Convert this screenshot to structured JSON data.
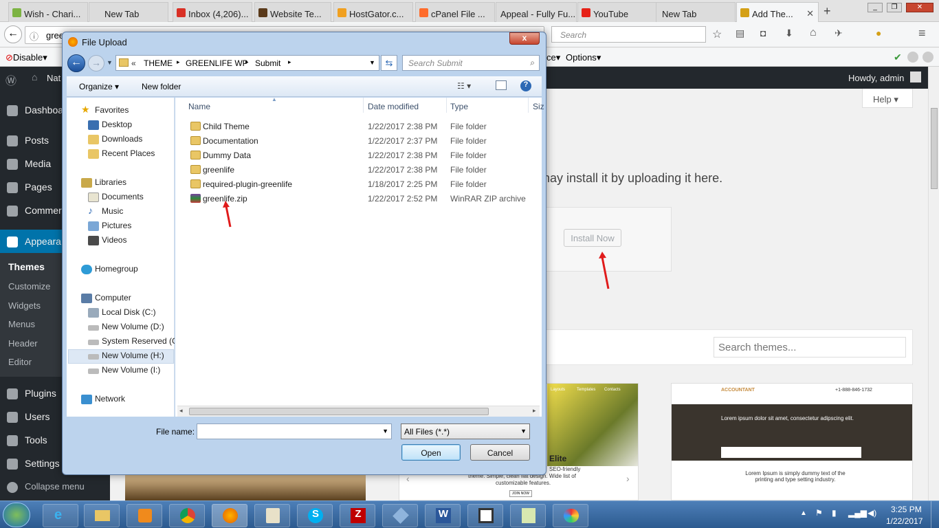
{
  "browser": {
    "tabs": [
      {
        "label": "Wish - Chari...",
        "icon_color": "#7cb342"
      },
      {
        "label": "New Tab",
        "icon_color": ""
      },
      {
        "label": "Inbox (4,206)...",
        "icon_color": "#d93025"
      },
      {
        "label": "Website Te...",
        "icon_color": "#5a3a1a"
      },
      {
        "label": "HostGator.c...",
        "icon_color": "#f0a020"
      },
      {
        "label": "cPanel File ...",
        "icon_color": "#ff6c2c"
      },
      {
        "label": "Appeal - Fully Fu...",
        "icon_color": ""
      },
      {
        "label": "YouTube",
        "icon_color": "#e62117"
      },
      {
        "label": "New Tab",
        "icon_color": ""
      },
      {
        "label": "Add The...",
        "icon_color": "#d4a017"
      }
    ],
    "new_tab_symbol": "+",
    "url_text": "gree",
    "search_placeholder": "Search",
    "addon_disable_label": "Disable",
    "addon_options_label": "Options",
    "addon_ce_label": "ce"
  },
  "wp": {
    "adminbar_site": "Nat",
    "howdy": "Howdy, admin",
    "help_label": "Help",
    "menu": [
      {
        "label": "Dashboa",
        "icon": "dashboard-icon"
      },
      {
        "label": "Posts",
        "icon": "pin-icon"
      },
      {
        "label": "Media",
        "icon": "media-icon"
      },
      {
        "label": "Pages",
        "icon": "page-icon"
      },
      {
        "label": "Commer",
        "icon": "comment-icon"
      },
      {
        "label": "Appeara",
        "icon": "brush-icon"
      }
    ],
    "submenu": [
      "Themes",
      "Customize",
      "Widgets",
      "Menus",
      "Header",
      "Editor"
    ],
    "menu2": [
      {
        "label": "Plugins",
        "icon": "plug-icon"
      },
      {
        "label": "Users",
        "icon": "user-icon"
      },
      {
        "label": "Tools",
        "icon": "wrench-icon"
      },
      {
        "label": "Settings",
        "icon": "settings-icon"
      },
      {
        "label": "Collapse menu",
        "icon": "collapse-icon"
      }
    ],
    "upload_hint": "nay install it by uploading it here.",
    "install_button": "Install Now",
    "search_themes_placeholder": "Search themes...",
    "theme1": {
      "nav": [
        "Layouts",
        "Templates",
        "Contacts"
      ],
      "name": "Elite",
      "desc1": "SEO-friendly",
      "desc2": "theme. Simple, clean flat design. Wide list of",
      "desc3": "customizable features.",
      "btn": "JOIN NOW"
    },
    "theme2": {
      "brand": "ACCOUNTANT",
      "phone": "+1-888-846-1732",
      "headline": "Lorem ipsum dolor sit amet, consectetur adipscing elit.",
      "body": "Lorem Ipsum is simply dummy text of the printing and type setting industry."
    }
  },
  "dialog": {
    "title": "File Upload",
    "close_symbol": "x",
    "breadcrumb": [
      "THEME",
      "GREENLIFE WP",
      "Submit"
    ],
    "breadcrumb_prefix": "«",
    "search_placeholder": "Search Submit",
    "organize_label": "Organize",
    "new_folder_label": "New folder",
    "columns": [
      "Name",
      "Date modified",
      "Type",
      "Siz"
    ],
    "nav": {
      "favorites_label": "Favorites",
      "favorites": [
        "Desktop",
        "Downloads",
        "Recent Places"
      ],
      "libraries_label": "Libraries",
      "libraries": [
        "Documents",
        "Music",
        "Pictures",
        "Videos"
      ],
      "homegroup_label": "Homegroup",
      "computer_label": "Computer",
      "drives": [
        "Local Disk (C:)",
        "New Volume (D:)",
        "System Reserved (G:",
        "New Volume (H:)",
        "New Volume (I:)"
      ],
      "network_label": "Network"
    },
    "files": [
      {
        "name": "Child Theme",
        "date": "1/22/2017 2:38 PM",
        "type": "File folder"
      },
      {
        "name": "Documentation",
        "date": "1/22/2017 2:37 PM",
        "type": "File folder"
      },
      {
        "name": "Dummy Data",
        "date": "1/22/2017 2:38 PM",
        "type": "File folder"
      },
      {
        "name": "greenlife",
        "date": "1/22/2017 2:38 PM",
        "type": "File folder"
      },
      {
        "name": "required-plugin-greenlife",
        "date": "1/18/2017 2:25 PM",
        "type": "File folder"
      },
      {
        "name": "greenlife.zip",
        "date": "1/22/2017 2:52 PM",
        "type": "WinRAR ZIP archive"
      }
    ],
    "filename_label": "File name:",
    "filename_value": "",
    "filter_value": "All Files (*.*)",
    "open_label": "Open",
    "cancel_label": "Cancel"
  },
  "taskbar": {
    "time": "3:25 PM",
    "date": "1/22/2017"
  }
}
